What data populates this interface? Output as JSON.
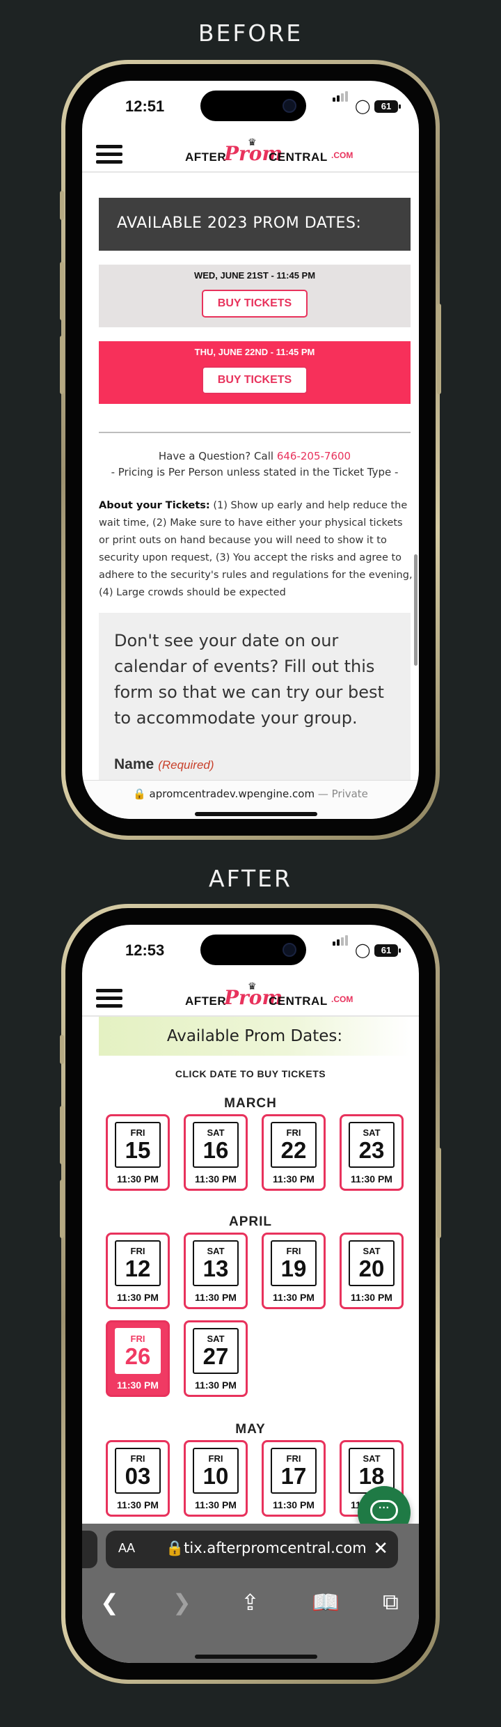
{
  "labels": {
    "before": "BEFORE",
    "after": "AFTER"
  },
  "before": {
    "status": {
      "time": "12:51",
      "battery": "61"
    },
    "logo": {
      "after": "AFTER",
      "prom": "Prom",
      "central": "CENTRAL",
      "dotcom": ".COM"
    },
    "banner": "AVAILABLE 2023 PROM DATES:",
    "dates": [
      {
        "date": "WED, JUNE 21ST - 11:45 PM",
        "button": "BUY TICKETS"
      },
      {
        "date": "THU, JUNE 22ND - 11:45 PM",
        "button": "BUY TICKETS"
      }
    ],
    "question": {
      "text": "Have a Question? Call ",
      "phone": "646-205-7600"
    },
    "pricing": "- Pricing is Per Person unless stated in the Ticket Type -",
    "about": {
      "label": "About your Tickets:",
      "text": " (1) Show up early and help reduce the wait time, (2) Make sure to have either your physical tickets or print outs on hand because you will need to show it to security upon request, (3) You accept the risks and agree to adhere to the security's rules and regulations for the evening, (4) Large crowds should be expected"
    },
    "form": {
      "text": "Don't see your date on our calendar of events? Fill out this form so that we can try our best to accommodate your group.",
      "name_label": "Name",
      "required": "(Required)"
    },
    "url": {
      "domain": "apromcentradev.wpengine.com",
      "suffix": " — Private"
    }
  },
  "after": {
    "status": {
      "time": "12:53",
      "battery": "61"
    },
    "logo": {
      "after": "AFTER",
      "prom": "Prom",
      "central": "CENTRAL",
      "dotcom": ".COM"
    },
    "banner": "Available Prom Dates:",
    "click_hint": "CLICK DATE TO BUY TICKETS",
    "months": [
      "MARCH",
      "APRIL",
      "MAY"
    ],
    "march": [
      {
        "dow": "FRI",
        "num": "15",
        "time": "11:30 PM"
      },
      {
        "dow": "SAT",
        "num": "16",
        "time": "11:30 PM"
      },
      {
        "dow": "FRI",
        "num": "22",
        "time": "11:30 PM"
      },
      {
        "dow": "SAT",
        "num": "23",
        "time": "11:30 PM"
      }
    ],
    "april": [
      {
        "dow": "FRI",
        "num": "12",
        "time": "11:30 PM"
      },
      {
        "dow": "SAT",
        "num": "13",
        "time": "11:30 PM"
      },
      {
        "dow": "FRI",
        "num": "19",
        "time": "11:30 PM"
      },
      {
        "dow": "SAT",
        "num": "20",
        "time": "11:30 PM"
      },
      {
        "dow": "FRI",
        "num": "26",
        "time": "11:30 PM"
      },
      {
        "dow": "SAT",
        "num": "27",
        "time": "11:30 PM"
      }
    ],
    "may": [
      {
        "dow": "FRI",
        "num": "03",
        "time": "11:30 PM"
      },
      {
        "dow": "FRI",
        "num": "10",
        "time": "11:30 PM"
      },
      {
        "dow": "FRI",
        "num": "17",
        "time": "11:30 PM"
      },
      {
        "dow": "SAT",
        "num": "18",
        "time": "11:30 PM"
      }
    ],
    "address": {
      "aa": "AA",
      "url": "tix.afterpromcentral.com"
    }
  }
}
